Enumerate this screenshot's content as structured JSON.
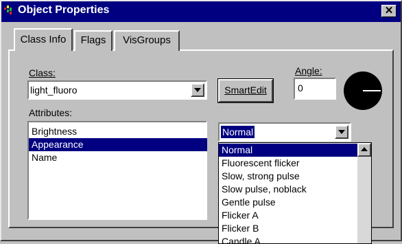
{
  "window": {
    "title": "Object Properties",
    "close_glyph": "✕"
  },
  "tabs": [
    {
      "label": "Class Info"
    },
    {
      "label": "Flags"
    },
    {
      "label": "VisGroups"
    }
  ],
  "class_field": {
    "label": "Class:",
    "value": "light_fluoro"
  },
  "smartedit": {
    "label": "SmartEdit"
  },
  "angle": {
    "label": "Angle:",
    "value": "0",
    "degrees": 0
  },
  "attributes": {
    "label": "Attributes:",
    "items": [
      "Brightness",
      "Appearance",
      "Name"
    ],
    "selected_index": 1
  },
  "appearance_combo": {
    "value": "Normal",
    "options": [
      "Normal",
      "Fluorescent flicker",
      "Slow, strong pulse",
      "Slow pulse, noblack",
      "Gentle pulse",
      "Flicker A",
      "Flicker B",
      "Candle A"
    ],
    "selected_index": 0
  },
  "colors": {
    "titlebar": "#000080",
    "selection": "#000080",
    "face": "#c0c0c0"
  }
}
